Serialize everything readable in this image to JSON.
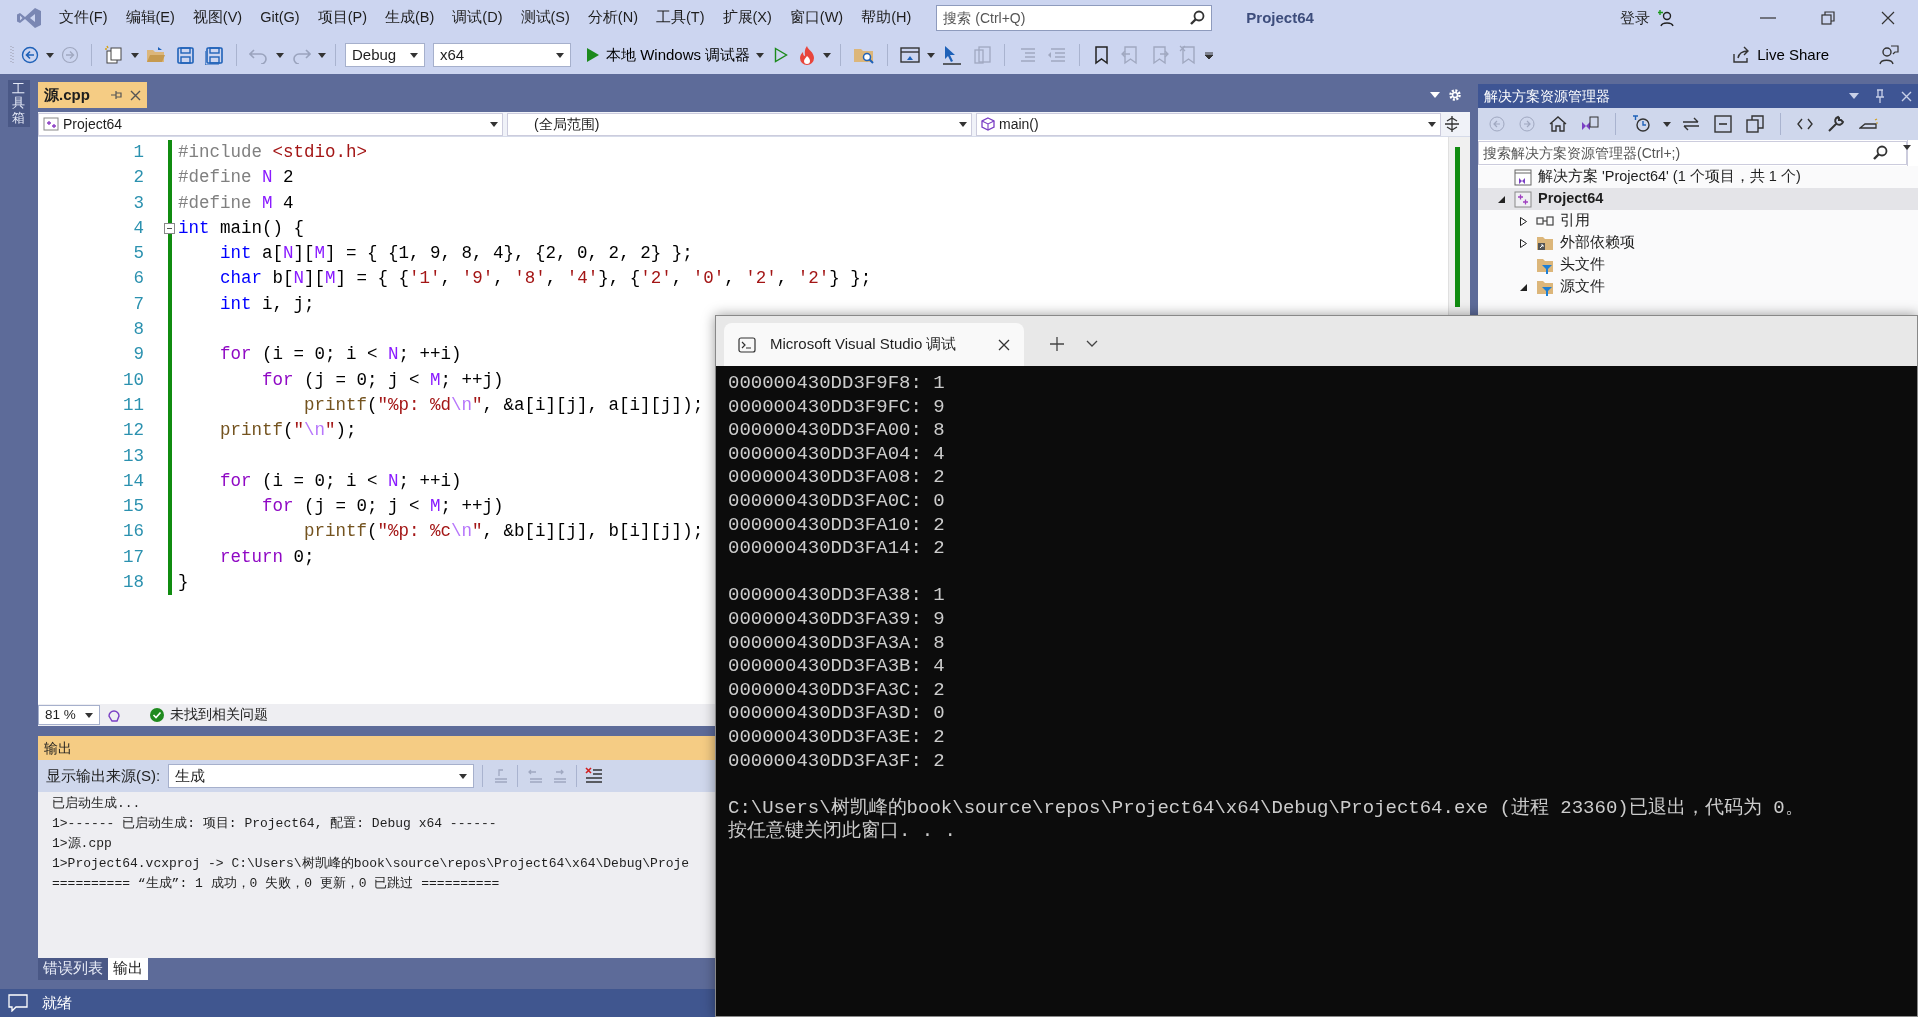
{
  "menu": [
    "文件(F)",
    "编辑(E)",
    "视图(V)",
    "Git(G)",
    "项目(P)",
    "生成(B)",
    "调试(D)",
    "测试(S)",
    "分析(N)",
    "工具(T)",
    "扩展(X)",
    "窗口(W)",
    "帮助(H)"
  ],
  "search": {
    "placeholder": "搜索 (Ctrl+Q)"
  },
  "title": "Project64",
  "sign_in": "登录",
  "toolbar": {
    "configuration": "Debug",
    "platform": "x64",
    "debugger": "本地 Windows 调试器",
    "live_share": "Live Share"
  },
  "toolbox": "工具箱",
  "editor": {
    "tab": {
      "label": "源.cpp",
      "selected": true
    },
    "nav": [
      "Project64",
      "(全局范围)",
      "main()"
    ],
    "lines": [
      {
        "number": "1",
        "tokens": [
          {
            "kind": "pre",
            "text": "#include "
          },
          {
            "kind": "str",
            "text": "<stdio.h>"
          }
        ]
      },
      {
        "number": "2",
        "tokens": [
          {
            "kind": "pre",
            "text": "#define "
          },
          {
            "kind": "mac",
            "text": "N"
          },
          {
            "kind": "txt",
            "text": " 2"
          }
        ]
      },
      {
        "number": "3",
        "tokens": [
          {
            "kind": "pre",
            "text": "#define "
          },
          {
            "kind": "mac",
            "text": "M"
          },
          {
            "kind": "txt",
            "text": " 4"
          }
        ]
      },
      {
        "number": "4",
        "folded": false,
        "tokens": [
          {
            "kind": "kw",
            "text": "int"
          },
          {
            "kind": "txt",
            "text": " main() {"
          }
        ]
      },
      {
        "number": "5",
        "tokens": [
          {
            "kind": "kw",
            "text": "    int"
          },
          {
            "kind": "txt",
            "text": " a["
          },
          {
            "kind": "mac",
            "text": "N"
          },
          {
            "kind": "txt",
            "text": "]["
          },
          {
            "kind": "mac",
            "text": "M"
          },
          {
            "kind": "txt",
            "text": "] = { {1, 9, 8, 4}, {2, 0, 2, 2} };"
          }
        ]
      },
      {
        "number": "6",
        "tokens": [
          {
            "kind": "kw",
            "text": "    char"
          },
          {
            "kind": "txt",
            "text": " b["
          },
          {
            "kind": "mac",
            "text": "N"
          },
          {
            "kind": "txt",
            "text": "]["
          },
          {
            "kind": "mac",
            "text": "M"
          },
          {
            "kind": "txt",
            "text": "] = { {"
          },
          {
            "kind": "str",
            "text": "'1'"
          },
          {
            "kind": "txt",
            "text": ", "
          },
          {
            "kind": "str",
            "text": "'9'"
          },
          {
            "kind": "txt",
            "text": ", "
          },
          {
            "kind": "str",
            "text": "'8'"
          },
          {
            "kind": "txt",
            "text": ", "
          },
          {
            "kind": "str",
            "text": "'4'"
          },
          {
            "kind": "txt",
            "text": "}, {"
          },
          {
            "kind": "str",
            "text": "'2'"
          },
          {
            "kind": "txt",
            "text": ", "
          },
          {
            "kind": "str",
            "text": "'0'"
          },
          {
            "kind": "txt",
            "text": ", "
          },
          {
            "kind": "str",
            "text": "'2'"
          },
          {
            "kind": "txt",
            "text": ", "
          },
          {
            "kind": "str",
            "text": "'2'"
          },
          {
            "kind": "txt",
            "text": "} };"
          }
        ]
      },
      {
        "number": "7",
        "tokens": [
          {
            "kind": "kw",
            "text": "    int"
          },
          {
            "kind": "txt",
            "text": " i, j;"
          }
        ]
      },
      {
        "number": "8"
      },
      {
        "number": "9",
        "tokens": [
          {
            "kind": "ctl",
            "text": "    for"
          },
          {
            "kind": "txt",
            "text": " (i = 0; i < "
          },
          {
            "kind": "mac",
            "text": "N"
          },
          {
            "kind": "txt",
            "text": "; ++i)"
          }
        ]
      },
      {
        "number": "10",
        "tokens": [
          {
            "kind": "ctl",
            "text": "        for"
          },
          {
            "kind": "txt",
            "text": " (j = 0; j < "
          },
          {
            "kind": "mac",
            "text": "M"
          },
          {
            "kind": "txt",
            "text": "; ++j)"
          }
        ]
      },
      {
        "number": "11",
        "tokens": [
          {
            "kind": "fn",
            "text": "            printf"
          },
          {
            "kind": "txt",
            "text": "("
          },
          {
            "kind": "str",
            "text": "\"%p: %d"
          },
          {
            "kind": "esc",
            "text": "\\n"
          },
          {
            "kind": "str",
            "text": "\""
          },
          {
            "kind": "txt",
            "text": ", &a[i][j], a[i][j]);"
          }
        ]
      },
      {
        "number": "12",
        "tokens": [
          {
            "kind": "fn",
            "text": "    printf"
          },
          {
            "kind": "txt",
            "text": "("
          },
          {
            "kind": "str",
            "text": "\""
          },
          {
            "kind": "esc",
            "text": "\\n"
          },
          {
            "kind": "str",
            "text": "\""
          },
          {
            "kind": "txt",
            "text": ");"
          }
        ]
      },
      {
        "number": "13"
      },
      {
        "number": "14",
        "tokens": [
          {
            "kind": "ctl",
            "text": "    for"
          },
          {
            "kind": "txt",
            "text": " (i = 0; i < "
          },
          {
            "kind": "mac",
            "text": "N"
          },
          {
            "kind": "txt",
            "text": "; ++i)"
          }
        ]
      },
      {
        "number": "15",
        "tokens": [
          {
            "kind": "ctl",
            "text": "        for"
          },
          {
            "kind": "txt",
            "text": " (j = 0; j < "
          },
          {
            "kind": "mac",
            "text": "M"
          },
          {
            "kind": "txt",
            "text": "; ++j)"
          }
        ]
      },
      {
        "number": "16",
        "tokens": [
          {
            "kind": "fn",
            "text": "            printf"
          },
          {
            "kind": "txt",
            "text": "("
          },
          {
            "kind": "str",
            "text": "\"%p: %c"
          },
          {
            "kind": "esc",
            "text": "\\n"
          },
          {
            "kind": "str",
            "text": "\""
          },
          {
            "kind": "txt",
            "text": ", &b[i][j], b[i][j]);"
          }
        ]
      },
      {
        "number": "17",
        "tokens": [
          {
            "kind": "ctl",
            "text": "    return"
          },
          {
            "kind": "txt",
            "text": " 0;"
          }
        ]
      },
      {
        "number": "18",
        "tokens": [
          {
            "kind": "txt",
            "text": "}"
          }
        ]
      }
    ],
    "zoom": "81 %",
    "issues": "未找到相关问题"
  },
  "output": {
    "title": "输出",
    "source_label": "显示输出来源(S):",
    "source": "生成",
    "lines": [
      "已启动生成...",
      "1>------ 已启动生成: 项目: Project64, 配置: Debug x64 ------",
      "1>源.cpp",
      "1>Project64.vcxproj -> C:\\Users\\树凯峰的book\\source\\repos\\Project64\\x64\\Debug\\Proje",
      "========== “生成”: 1 成功，0 失败，0 更新，0 已跳过 =========="
    ],
    "tabs": [
      {
        "label": "错误列表",
        "selected": false
      },
      {
        "label": "输出",
        "selected": true
      }
    ]
  },
  "solution_explorer": {
    "title": "解决方案资源管理器",
    "search": {
      "placeholder": "搜索解决方案资源管理器(Ctrl+;)"
    },
    "tree": [
      {
        "label": "解决方案 'Project64' (1 个项目，共 1 个)",
        "kind": "solution",
        "selected": false,
        "children": [
          {
            "label": "Project64",
            "kind": "project",
            "selected": true,
            "expanded": true,
            "children": [
              {
                "label": "引用",
                "kind": "references",
                "selected": false,
                "expanded": false
              },
              {
                "label": "外部依赖项",
                "kind": "external",
                "selected": false,
                "expanded": false
              },
              {
                "label": "头文件",
                "kind": "filter",
                "selected": false
              },
              {
                "label": "源文件",
                "kind": "filter",
                "selected": false,
                "expanded": true
              }
            ]
          }
        ]
      }
    ]
  },
  "terminal": {
    "tab": "Microsoft Visual Studio 调试",
    "blocks": [
      [
        "000000430DD3F9F8: 1",
        "000000430DD3F9FC: 9",
        "000000430DD3FA00: 8",
        "000000430DD3FA04: 4",
        "000000430DD3FA08: 2",
        "000000430DD3FA0C: 0",
        "000000430DD3FA10: 2",
        "000000430DD3FA14: 2"
      ],
      [
        "000000430DD3FA38: 1",
        "000000430DD3FA39: 9",
        "000000430DD3FA3A: 8",
        "000000430DD3FA3B: 4",
        "000000430DD3FA3C: 2",
        "000000430DD3FA3D: 0",
        "000000430DD3FA3E: 2",
        "000000430DD3FA3F: 2"
      ],
      [
        "C:\\Users\\树凯峰的book\\source\\repos\\Project64\\x64\\Debug\\Project64.exe (进程 23360)已退出，代码为 0。",
        "按任意键关闭此窗口. . ."
      ]
    ]
  },
  "status_bar": "就绪"
}
